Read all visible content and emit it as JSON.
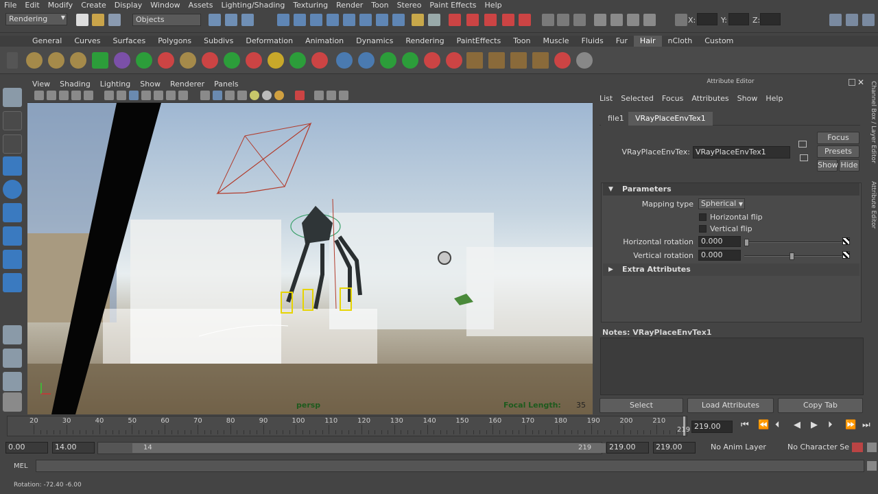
{
  "menubar": [
    "File",
    "Edit",
    "Modify",
    "Create",
    "Display",
    "Window",
    "Assets",
    "Lighting/Shading",
    "Texturing",
    "Render",
    "Toon",
    "Stereo",
    "Paint Effects",
    "Help"
  ],
  "status": {
    "mode": "Rendering",
    "selection_mask": "Objects",
    "x_label": "X:",
    "y_label": "Y:",
    "z_label": "Z:"
  },
  "shelf_tabs": [
    "General",
    "Curves",
    "Surfaces",
    "Polygons",
    "Subdivs",
    "Deformation",
    "Animation",
    "Dynamics",
    "Rendering",
    "PaintEffects",
    "Toon",
    "Muscle",
    "Fluids",
    "Fur",
    "Hair",
    "nCloth",
    "Custom"
  ],
  "active_shelf_tab": "Hair",
  "viewport": {
    "menu": [
      "View",
      "Shading",
      "Lighting",
      "Show",
      "Renderer",
      "Panels"
    ],
    "camera": "persp",
    "focal_label": "Focal Length:",
    "focal_value": "35"
  },
  "attribute_editor": {
    "title": "Attribute Editor",
    "menu": [
      "List",
      "Selected",
      "Focus",
      "Attributes",
      "Show",
      "Help"
    ],
    "tabs": [
      "file1",
      "VRayPlaceEnvTex1"
    ],
    "active_tab": "VRayPlaceEnvTex1",
    "node_label": "VRayPlaceEnvTex:",
    "node_value": "VRayPlaceEnvTex1",
    "focus_btn": "Focus",
    "presets_btn": "Presets",
    "show_btn": "Show",
    "hide_btn": "Hide",
    "params_header": "Parameters",
    "mapping_label": "Mapping type",
    "mapping_value": "Spherical",
    "hflip_label": "Horizontal flip",
    "vflip_label": "Vertical flip",
    "hrot_label": "Horizontal rotation",
    "hrot_value": "0.000",
    "vrot_label": "Vertical rotation",
    "vrot_value": "0.000",
    "extra_header": "Extra Attributes",
    "notes_label": "Notes:  VRayPlaceEnvTex1",
    "select_btn": "Select",
    "load_btn": "Load Attributes",
    "copy_btn": "Copy Tab"
  },
  "side_tabs": [
    "Channel Box / Layer Editor",
    "Attribute Editor"
  ],
  "timeline": {
    "ticks": [
      "20",
      "30",
      "40",
      "50",
      "60",
      "70",
      "80",
      "90",
      "100",
      "110",
      "120",
      "130",
      "140",
      "150",
      "160",
      "170",
      "180",
      "190",
      "200",
      "210"
    ],
    "current_frame": "219",
    "current_field": "219.00"
  },
  "range": {
    "start": "0.00",
    "playback_start": "14.00",
    "range_start": "14",
    "range_end": "219",
    "playback_end": "219.00",
    "end": "219.00",
    "anim_layer": "No Anim Layer",
    "char_set": "No Character Set"
  },
  "cmd": {
    "label": "MEL"
  },
  "help": {
    "text": "Rotation:  -72.40    -6.00"
  },
  "colors": {
    "panel": "#444444",
    "accent": "#5a5a5a",
    "field": "#2b2b2b"
  }
}
